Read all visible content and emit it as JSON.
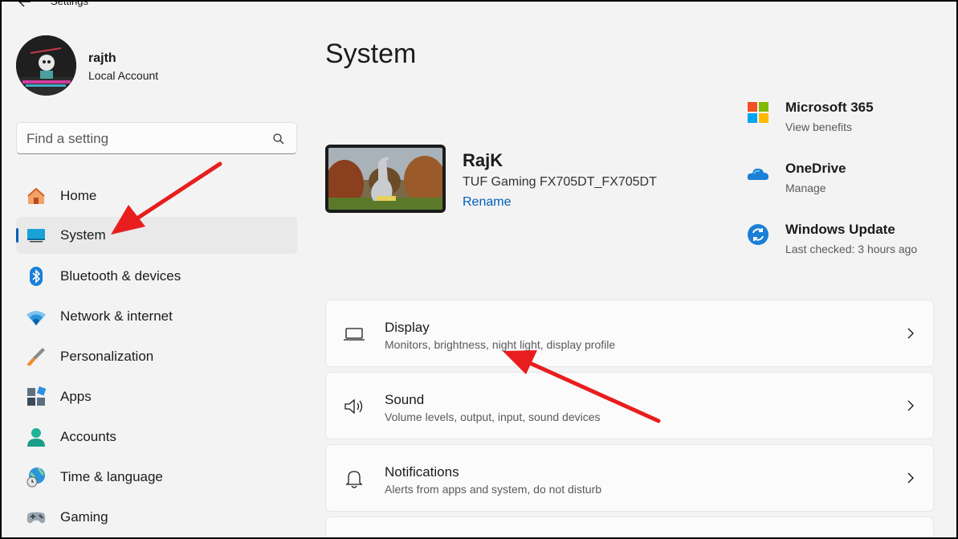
{
  "window": {
    "title": "Settings"
  },
  "profile": {
    "name": "rajth",
    "account_type": "Local Account"
  },
  "search": {
    "placeholder": "Find a setting"
  },
  "sidebar": {
    "items": [
      {
        "label": "Home",
        "icon": "home-icon"
      },
      {
        "label": "System",
        "icon": "system-icon",
        "active": true
      },
      {
        "label": "Bluetooth & devices",
        "icon": "bluetooth-icon"
      },
      {
        "label": "Network & internet",
        "icon": "wifi-icon"
      },
      {
        "label": "Personalization",
        "icon": "brush-icon"
      },
      {
        "label": "Apps",
        "icon": "apps-icon"
      },
      {
        "label": "Accounts",
        "icon": "accounts-icon"
      },
      {
        "label": "Time & language",
        "icon": "globe-clock-icon"
      },
      {
        "label": "Gaming",
        "icon": "gamepad-icon"
      }
    ]
  },
  "main": {
    "title": "System",
    "device": {
      "name": "RajK",
      "model": "TUF Gaming FX705DT_FX705DT",
      "rename_label": "Rename"
    },
    "quick_links": [
      {
        "title": "Microsoft 365",
        "subtitle": "View benefits",
        "icon": "microsoft-365-icon"
      },
      {
        "title": "OneDrive",
        "subtitle": "Manage",
        "icon": "onedrive-icon"
      },
      {
        "title": "Windows Update",
        "subtitle": "Last checked: 3 hours ago",
        "icon": "windows-update-icon"
      }
    ],
    "cards": [
      {
        "title": "Display",
        "subtitle": "Monitors, brightness, night light, display profile",
        "icon": "laptop-icon"
      },
      {
        "title": "Sound",
        "subtitle": "Volume levels, output, input, sound devices",
        "icon": "speaker-icon"
      },
      {
        "title": "Notifications",
        "subtitle": "Alerts from apps and system, do not disturb",
        "icon": "bell-icon"
      }
    ]
  },
  "colors": {
    "accent": "#005fb8",
    "annotation_arrow": "#e81e1e",
    "background": "#f3f3f3",
    "card": "#fbfbfb"
  }
}
